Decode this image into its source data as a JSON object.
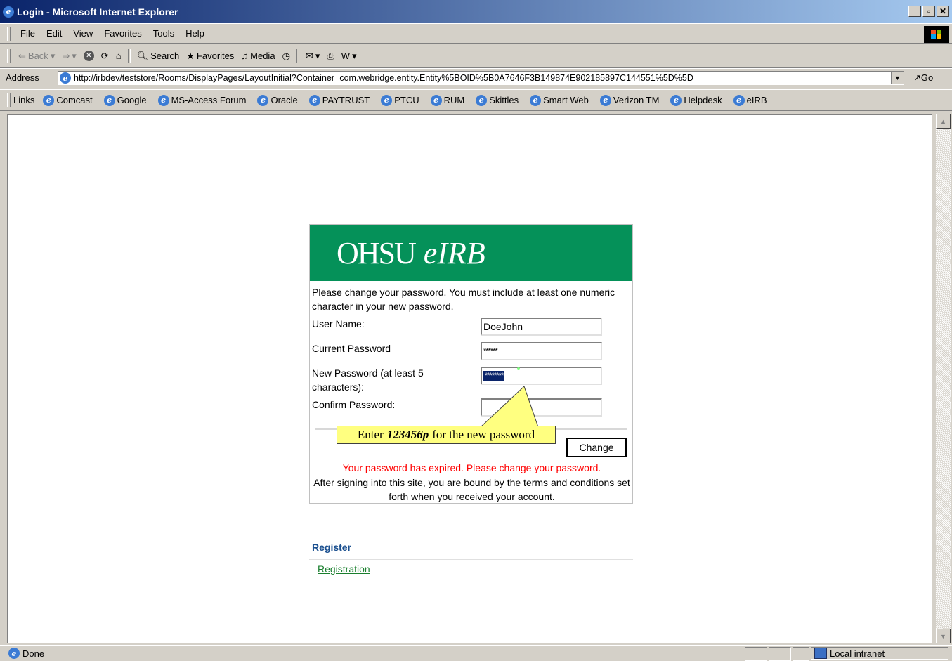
{
  "window": {
    "title": "Login - Microsoft Internet Explorer"
  },
  "menu": [
    "File",
    "Edit",
    "View",
    "Favorites",
    "Tools",
    "Help"
  ],
  "toolbar": {
    "back": "Back",
    "search": "Search",
    "favorites": "Favorites",
    "media": "Media"
  },
  "address": {
    "label": "Address",
    "url": "http://irbdev/teststore/Rooms/DisplayPages/LayoutInitial?Container=com.webridge.entity.Entity%5BOID%5B0A7646F3B149874E902185897C144551%5D%5D",
    "go": "Go"
  },
  "links": {
    "label": "Links",
    "items": [
      "Comcast",
      "Google",
      "MS-Access Forum",
      "Oracle",
      "PAYTRUST",
      "PTCU",
      "RUM",
      "Skittles",
      "Smart Web",
      "Verizon TM",
      "Helpdesk",
      "eIRB"
    ]
  },
  "banner": {
    "brand": "OHSU",
    "product": "eIRB"
  },
  "form": {
    "intro": "Please change your password. You must include at least one numeric character in your new password.",
    "username_label": "User Name:",
    "username_value": "DoeJohn",
    "current_label": "Current Password",
    "current_value": "******",
    "new_label": "New Password (at least 5 characters):",
    "new_value": "********",
    "confirm_label": "Confirm Password:",
    "confirm_value": "",
    "change_button": "Change",
    "error": "Your password has expired. Please change your password.",
    "terms": "After signing into this site, you are bound by the terms and conditions set forth when you received your account."
  },
  "tooltip": {
    "before": "Enter",
    "value": "123456p",
    "after": "for the new password"
  },
  "register": {
    "heading": "Register",
    "link": "Registration"
  },
  "status": {
    "text": "Done",
    "zone": "Local intranet"
  }
}
